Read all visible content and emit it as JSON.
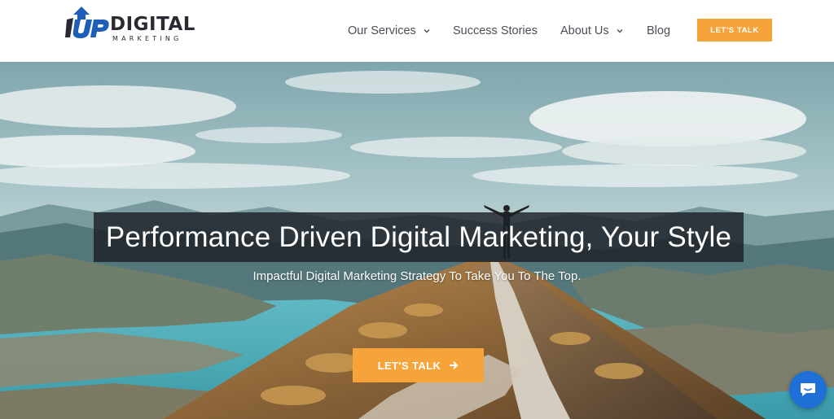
{
  "logo": {
    "mark_text": "1UP",
    "word": "DIGITAL",
    "sub": "MARKETING"
  },
  "nav": {
    "items": [
      {
        "label": "Our Services",
        "has_dropdown": true
      },
      {
        "label": "Success Stories",
        "has_dropdown": false
      },
      {
        "label": "About Us",
        "has_dropdown": true
      },
      {
        "label": "Blog",
        "has_dropdown": false
      }
    ],
    "cta_label": "LET'S TALK"
  },
  "hero": {
    "headline": "Performance Driven Digital Marketing, Your Style",
    "subheadline": "Impactful Digital Marketing Strategy To Take You To The Top.",
    "cta_label": "LET'S TALK"
  },
  "icons": {
    "dropdown": "chevron-down-icon",
    "cta_arrow": "arrow-right-icon",
    "chat": "chat-bubble-icon"
  },
  "colors": {
    "accent": "#f6a43a",
    "logo_blue": "#1d5fb8",
    "logo_dark": "#2a2a33",
    "nav_text": "#4d4d57",
    "chat_blue": "#1e6fd6"
  }
}
